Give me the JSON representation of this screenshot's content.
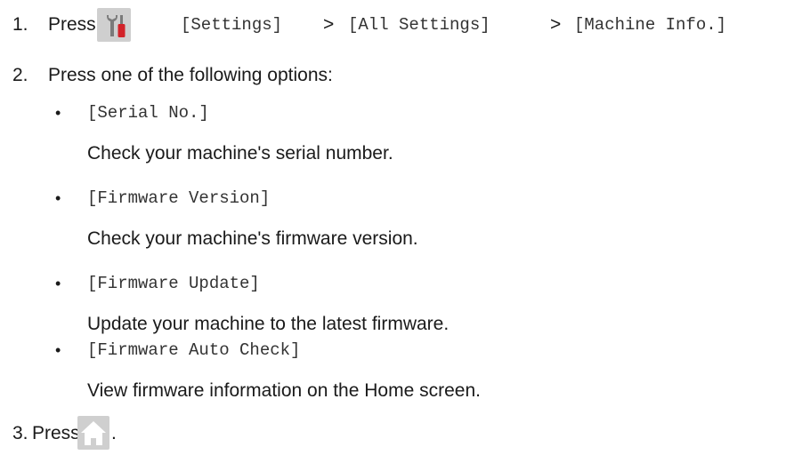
{
  "steps": [
    {
      "number": "1.",
      "press": "Press",
      "menu_path": [
        "[Settings]",
        "[All Settings]",
        "[Machine Info.]"
      ],
      "separator": ">",
      "icon": "settings-tools-icon"
    },
    {
      "number": "2.",
      "text": "Press one of the following options:"
    },
    {
      "number": "3.",
      "press": "Press",
      "end_punctuation": ".",
      "icon": "home-icon"
    }
  ],
  "options": [
    {
      "label": "[Serial No.]",
      "description": "Check your machine's serial number."
    },
    {
      "label": "[Firmware Version]",
      "description": "Check your machine's firmware version."
    },
    {
      "label": "[Firmware Update]",
      "description": "Update your machine to the latest firmware."
    },
    {
      "label": "[Firmware Auto Check]",
      "description": "View firmware information on the Home screen."
    }
  ],
  "bullet_char": "•",
  "colors": {
    "icon_bg": "#cfcfcf",
    "wrench_gray": "#7a7a7a",
    "screwdriver_red": "#d2232a",
    "text": "#1a1a1a"
  }
}
